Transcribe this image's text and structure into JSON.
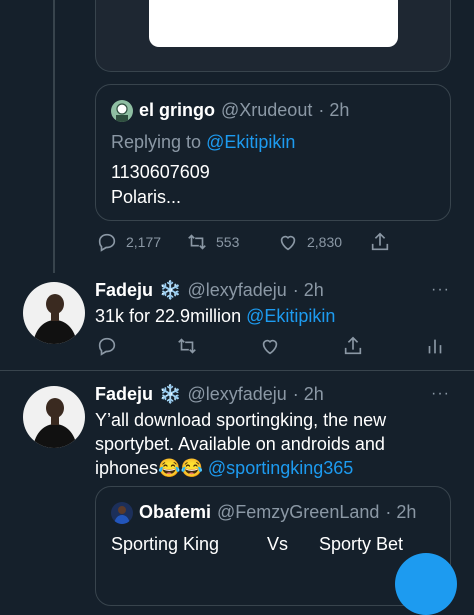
{
  "quoted_tweet": {
    "name": "el gringo",
    "handle": "@Xrudeout",
    "time": "· 2h",
    "replying_prefix": "Replying to",
    "replying_to": "@Ekitipikin",
    "line1": "1130607609",
    "line2": "Polaris..."
  },
  "thread_actions": {
    "replies": "2,177",
    "retweets": "553",
    "likes": "2,830"
  },
  "tweet1": {
    "name": "Fadeju",
    "handle": "@lexyfadeju",
    "time": "· 2h",
    "text": "31k for 22.9million",
    "mention": "@Ekitipikin",
    "more": "···"
  },
  "tweet2": {
    "name": "Fadeju",
    "handle": "@lexyfadeju",
    "time": "· 2h",
    "line1": "Y’all download sportingking, the new",
    "line2": "sportybet. Available on androids and",
    "line3_text": "iphones",
    "emoji": "😂😂",
    "mention": "@sportingking365",
    "more": "···"
  },
  "quoted_tweet2": {
    "name": "Obafemi",
    "handle": "@FemzyGreenLand",
    "time": "· 2h",
    "col1": "Sporting King",
    "col2": "Vs",
    "col3": "Sporty Bet"
  },
  "colors": {
    "background": "#15202b",
    "accent": "#1d9bf0",
    "muted": "#8b98a5",
    "border": "#38444d"
  }
}
